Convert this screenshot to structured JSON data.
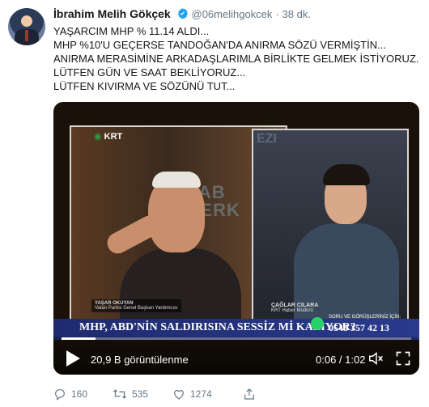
{
  "author": {
    "name": "İbrahim Melih Gökçek",
    "handle": "@06melihgokcek",
    "separator": "·",
    "time": "38 dk."
  },
  "tweet": {
    "lines": [
      "YAŞARCIM MHP % 11.14 ALDI...",
      "MHP %10'U GEÇERSE TANDOĞAN'DA ANIRMA SÖZÜ VERMİŞTİN...",
      "ANIRMA MERASİMİNE ARKADAŞLARIMLA BİRLİKTE GELMEK İSTİYORUZ.",
      "LÜTFEN GÜN VE SAAT BEKLİYORUZ...",
      "LÜTFEN KIVIRMA VE SÖZÜNÜ TUT..."
    ]
  },
  "video": {
    "channel_logo": "KRT",
    "left_background_text": "HAB\nMERK",
    "right_background_text": "EZI",
    "guest_left_name": "YAŞAR OKUYAN",
    "guest_left_title": "Vatan Partisi Genel Başkan Yardımcısı",
    "guest_right_name": "ÇAĞLAR CILARA",
    "guest_right_title": "KRT Haber Müdürü",
    "ticker_text": "MHP, ABD'NİN SALDIRISINA SESSİZ Mİ KALIYOR?",
    "ticker_contact_label": "SORU VE GÖRÜŞLERİNİZ İÇİN:",
    "ticker_phone": "0545 357 42 13",
    "views": "20,9 B görüntülenme",
    "time_display": "0:06 / 1:02",
    "progress_fraction": 0.097,
    "icons": [
      "play-icon",
      "volume-icon",
      "fullscreen-icon"
    ]
  },
  "actions": {
    "replies": "160",
    "retweets": "535",
    "likes": "1274"
  },
  "colors": {
    "verified": "#1da1f2",
    "muted": "#657786",
    "ticker": "#2a3a8c"
  }
}
